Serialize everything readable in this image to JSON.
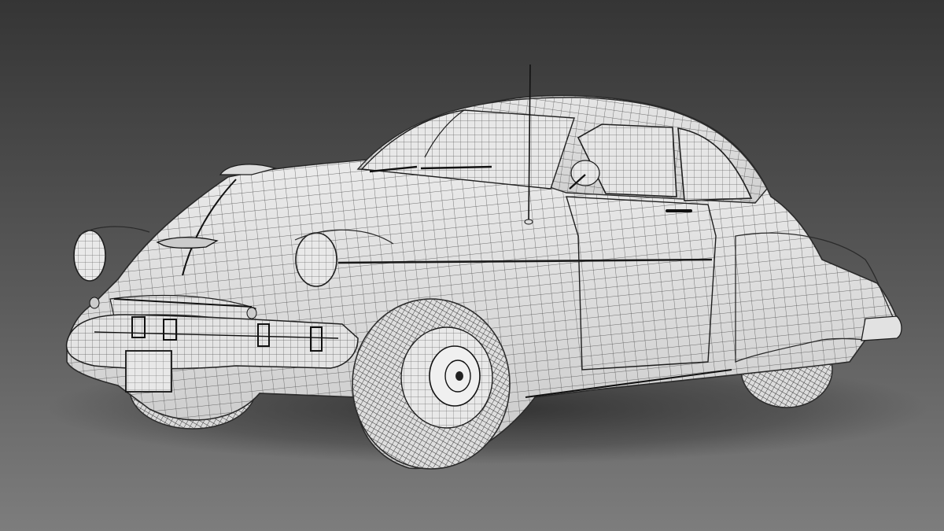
{
  "scene": {
    "subject": "vintage-coupe-wireframe-render",
    "colors": {
      "background_top": "#353535",
      "background_bottom": "#7a7a7a",
      "floor_shadow": "#2e2e2e",
      "body_fill": "#ececec",
      "body_shade": "#bdbdbd",
      "mesh_line": "#4a4a4a",
      "trim": "#1e1e1e"
    }
  }
}
